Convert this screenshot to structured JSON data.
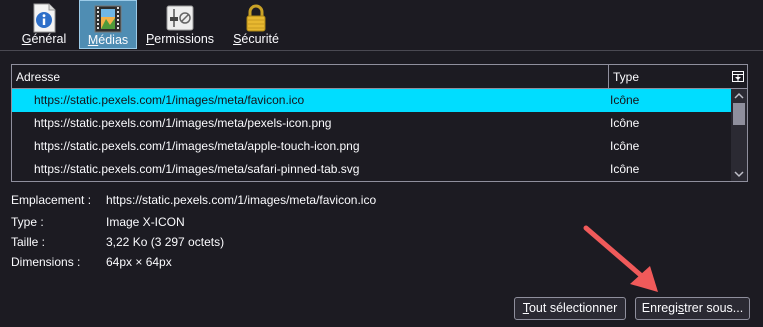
{
  "toolbar": {
    "tabs": [
      {
        "key": "G",
        "before": "",
        "after": "énéral",
        "icon": "info-icon"
      },
      {
        "key": "M",
        "before": "",
        "after": "édias",
        "icon": "media-image-icon",
        "active": true
      },
      {
        "key": "P",
        "before": "",
        "after": "ermissions",
        "icon": "permissions-sliders-icon"
      },
      {
        "key": "S",
        "before": "",
        "after": "écurité",
        "icon": "security-lock-icon"
      }
    ]
  },
  "table": {
    "headers": {
      "address": "Adresse",
      "type": "Type"
    },
    "rows": [
      {
        "address": "https://static.pexels.com/1/images/meta/favicon.ico",
        "type": "Icône",
        "selected": true
      },
      {
        "address": "https://static.pexels.com/1/images/meta/pexels-icon.png",
        "type": "Icône"
      },
      {
        "address": "https://static.pexels.com/1/images/meta/apple-touch-icon.png",
        "type": "Icône"
      },
      {
        "address": "https://static.pexels.com/1/images/meta/safari-pinned-tab.svg",
        "type": "Icône"
      }
    ]
  },
  "info": {
    "location_label": "Emplacement :",
    "location_value": "https://static.pexels.com/1/images/meta/favicon.ico",
    "type_label": "Type :",
    "type_value": "Image X-ICON",
    "size_label": "Taille :",
    "size_value": "3,22 Ko (3 297 octets)",
    "dimensions_label": "Dimensions :",
    "dimensions_value": "64px × 64px"
  },
  "buttons": {
    "select_all_key": "T",
    "select_all_rest": "out sélectionner",
    "save_before": "Enregi",
    "save_key": "s",
    "save_after": "trer sous..."
  },
  "colors": {
    "background": "#1c1b22",
    "selection": "#00ddff",
    "active_tab": "#4f8db3",
    "annotation_arrow": "#f05a5a"
  }
}
